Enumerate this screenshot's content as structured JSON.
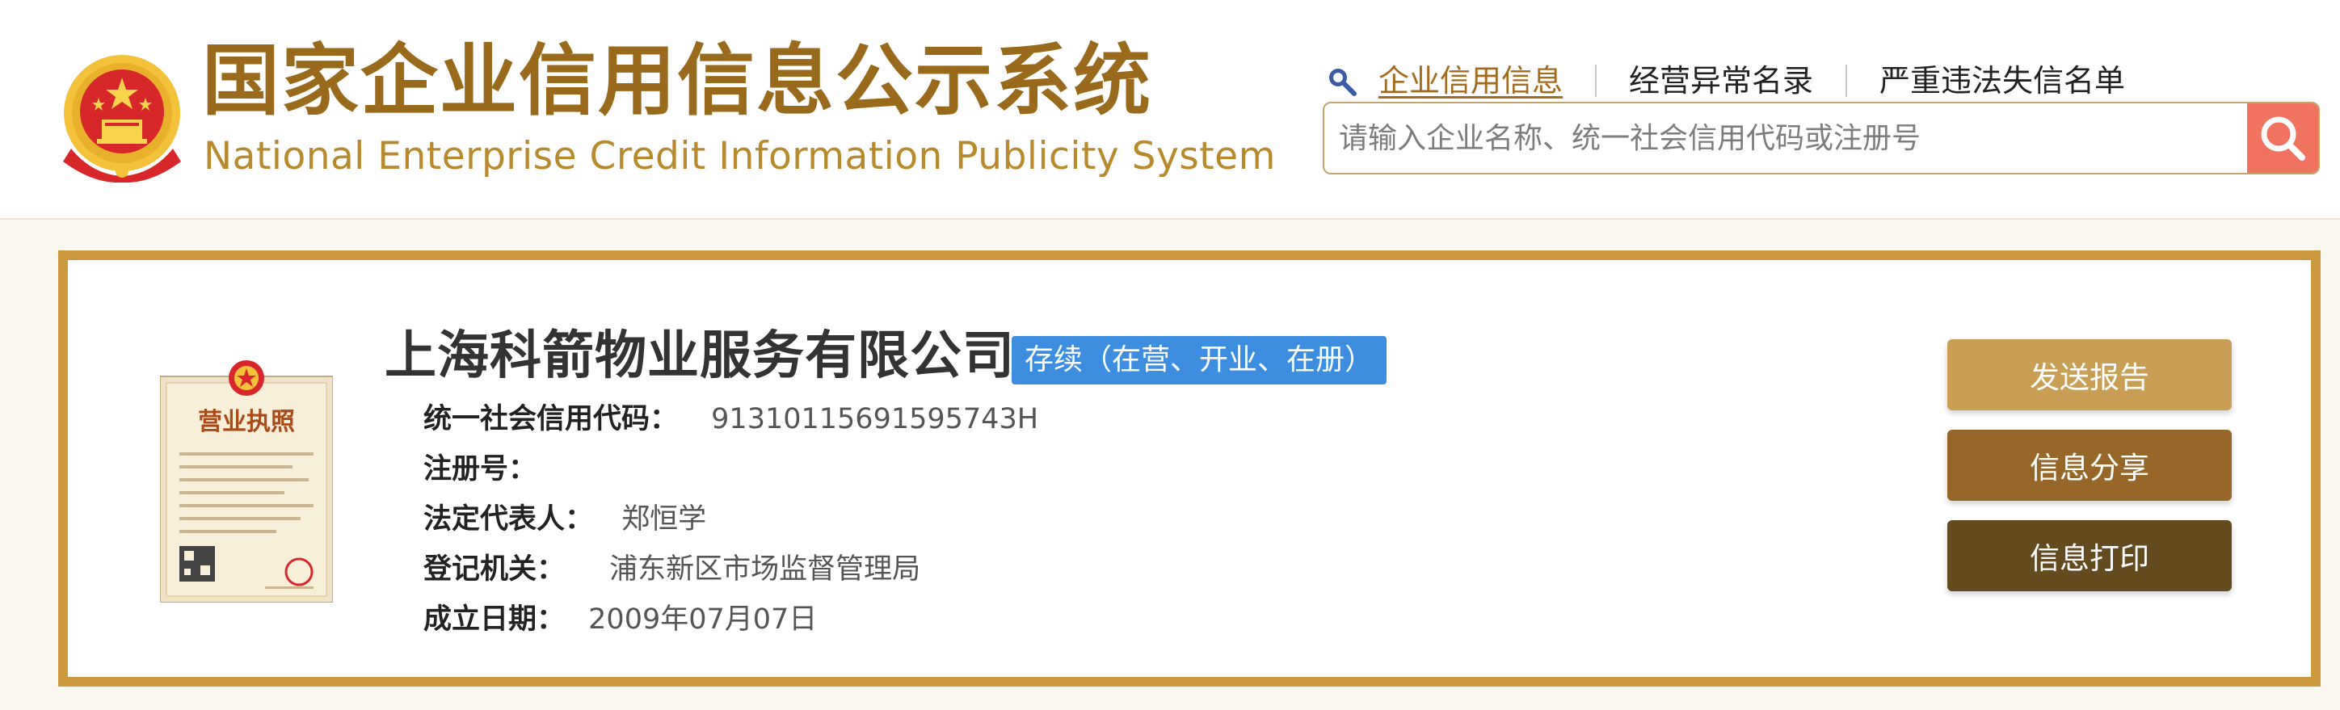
{
  "header": {
    "title_cn": "国家企业信用信息公示系统",
    "title_en": "National Enterprise Credit Information Publicity System"
  },
  "nav": {
    "items": [
      {
        "label": "企业信用信息",
        "active": true
      },
      {
        "label": "经营异常名录",
        "active": false
      },
      {
        "label": "严重违法失信名单",
        "active": false
      }
    ]
  },
  "search": {
    "placeholder": "请输入企业名称、统一社会信用代码或注册号",
    "value": ""
  },
  "company": {
    "name": "上海科箭物业服务有限公司",
    "status": "存续（在营、开业、在册）",
    "fields": {
      "credit_code": {
        "label": "统一社会信用代码：",
        "value": "91310115691595743H"
      },
      "reg_no": {
        "label": "注册号：",
        "value": ""
      },
      "legal_rep": {
        "label": "法定代表人：",
        "value": "郑恒学"
      },
      "authority": {
        "label": "登记机关：",
        "value": "浦东新区市场监督管理局"
      },
      "established": {
        "label": "成立日期：",
        "value": "2009年07月07日"
      }
    }
  },
  "license_image": {
    "heading": "营业执照"
  },
  "actions": {
    "send_report": "发送报告",
    "share": "信息分享",
    "print": "信息打印"
  },
  "colors": {
    "brand_gold": "#9a6a1c",
    "card_border": "#cc9a3c",
    "status_blue": "#3d8ee0",
    "search_red": "#f07260",
    "btn_send": "#c99f55",
    "btn_share": "#97672a",
    "btn_print": "#644a1f"
  },
  "icons": {
    "emblem": "national-emblem-icon",
    "search": "magnifier-icon"
  }
}
